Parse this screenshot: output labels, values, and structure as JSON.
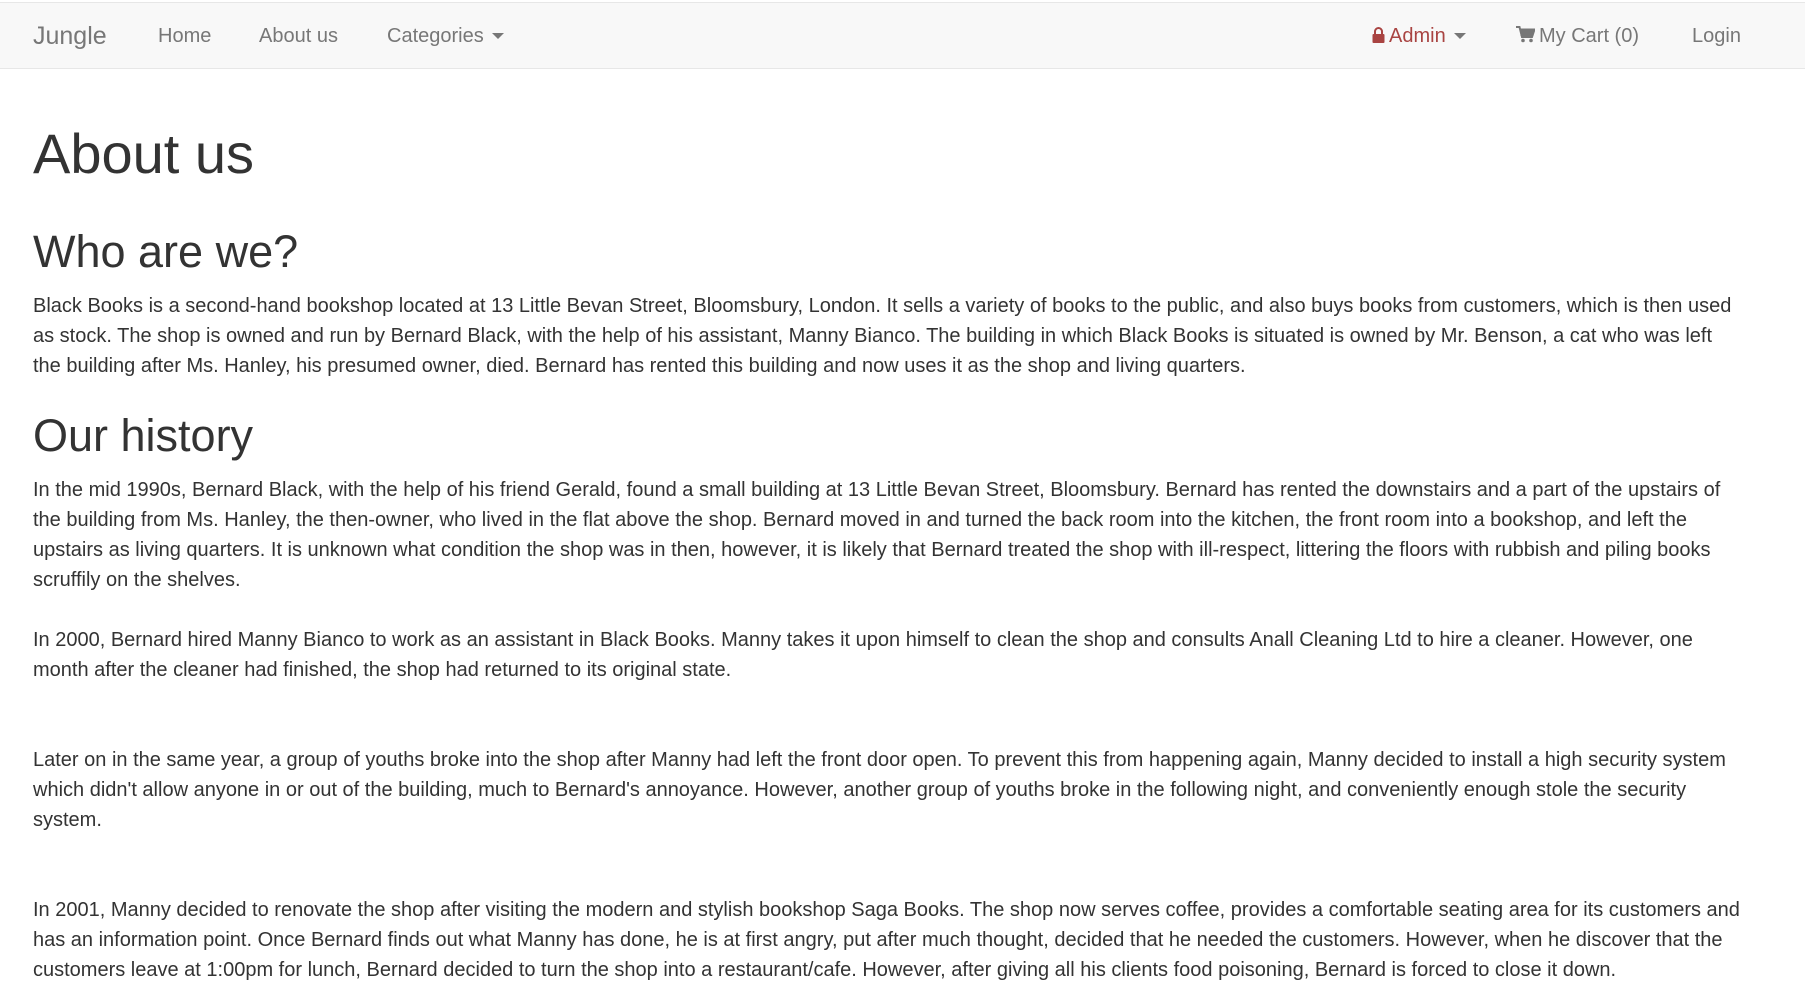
{
  "navbar": {
    "brand": "Jungle",
    "links": {
      "home": "Home",
      "about": "About us",
      "categories": "Categories"
    },
    "admin": "Admin",
    "cart": "My Cart (0)",
    "login": "Login",
    "colors": {
      "admin": "#a94442",
      "text": "#777777",
      "background": "#f8f8f8"
    }
  },
  "page": {
    "title": "About us",
    "who": {
      "heading": "Who are we?",
      "body": "Black Books is a second-hand bookshop located at 13 Little Bevan Street, Bloomsbury, London. It sells a variety of books to the public, and also buys books from customers, which is then used as stock. The shop is owned and run by Bernard Black, with the help of his assistant, Manny Bianco. The building in which Black Books is situated is owned by Mr. Benson, a cat who was left the building after Ms. Hanley, his presumed owner, died. Bernard has rented this building and now uses it as the shop and living quarters."
    },
    "history": {
      "heading": "Our history",
      "paragraphs": [
        "In the mid 1990s, Bernard Black, with the help of his friend Gerald, found a small building at 13 Little Bevan Street, Bloomsbury. Bernard has rented the downstairs and a part of the upstairs of the building from Ms. Hanley, the then-owner, who lived in the flat above the shop. Bernard moved in and turned the back room into the kitchen, the front room into a bookshop, and left the upstairs as living quarters. It is unknown what condition the shop was in then, however, it is likely that Bernard treated the shop with ill-respect, littering the floors with rubbish and piling books scruffily on the shelves.",
        "In 2000, Bernard hired Manny Bianco to work as an assistant in Black Books. Manny takes it upon himself to clean the shop and consults Anall Cleaning Ltd to hire a cleaner. However, one month after the cleaner had finished, the shop had returned to its original state.",
        "Later on in the same year, a group of youths broke into the shop after Manny had left the front door open. To prevent this from happening again, Manny decided to install a high security system which didn't allow anyone in or out of the building, much to Bernard's annoyance. However, another group of youths broke in the following night, and conveniently enough stole the security system.",
        "In 2001, Manny decided to renovate the shop after visiting the modern and stylish bookshop Saga Books. The shop now serves coffee, provides a comfortable seating area for its customers and has an information point. Once Bernard finds out what Manny has done, he is at first angry, put after much thought, decided that he needed the customers. However, when he discover that the customers leave at 1:00pm for lunch, Bernard decided to turn the shop into a restaurant/cafe. However, after giving all his clients food poisoning, Bernard is forced to close it down."
      ]
    }
  },
  "icons": {
    "admin": "lock-icon",
    "cart": "cart-icon",
    "dropdown": "caret-down-icon"
  }
}
